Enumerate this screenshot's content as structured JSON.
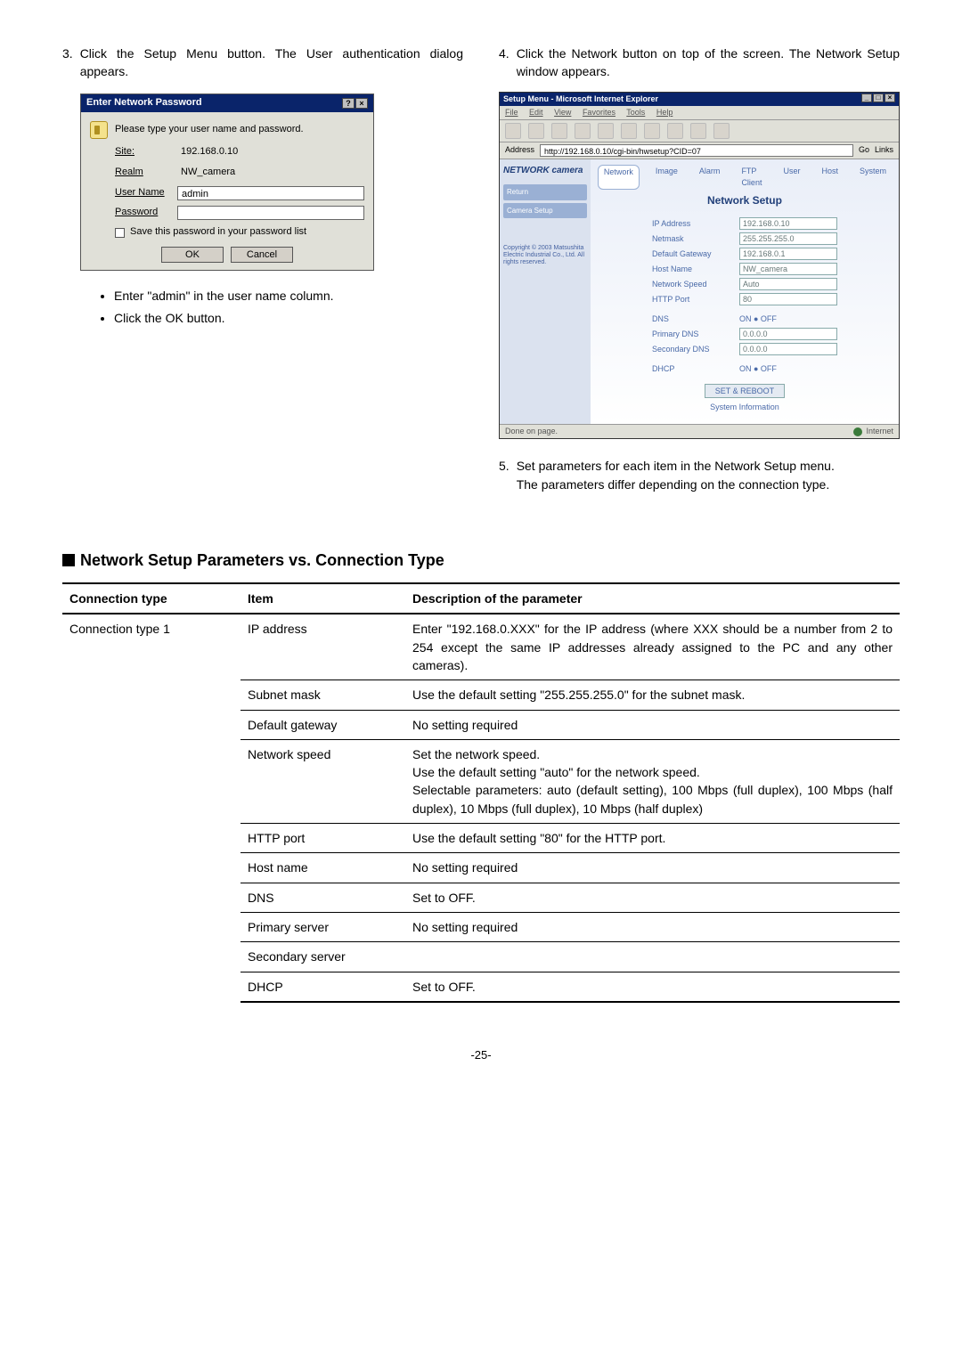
{
  "steps": {
    "s3": {
      "num": "3.",
      "text": "Click the Setup Menu button. The User authentication dialog appears."
    },
    "s4": {
      "num": "4.",
      "text": "Click the Network button on top of the screen. The Network Setup window appears."
    },
    "s5": {
      "num": "5.",
      "text": "Set parameters for each item in the Network Setup menu.",
      "note": "The parameters differ depending on the connection type."
    }
  },
  "bullets": {
    "b1": "Enter \"admin\" in the user name column.",
    "b2": "Click the OK button."
  },
  "dialog": {
    "title": "Enter Network Password",
    "prompt": "Please type your user name and password.",
    "site_label": "Site:",
    "site_value": "192.168.0.10",
    "realm_label": "Realm",
    "realm_value": "NW_camera",
    "user_label": "User Name",
    "user_value": "admin",
    "pass_label": "Password",
    "save_label": "Save this password in your password list",
    "ok": "OK",
    "cancel": "Cancel",
    "help_btn": "?",
    "close_btn": "×"
  },
  "browser": {
    "title": "Setup Menu - Microsoft Internet Explorer",
    "min": "_",
    "max": "□",
    "close": "×",
    "menu": {
      "file": "File",
      "edit": "Edit",
      "view": "View",
      "fav": "Favorites",
      "tools": "Tools",
      "help": "Help"
    },
    "addr_label": "Address",
    "addr_value": "http://192.168.0.10/cgi-bin/hwsetup?CID=07",
    "go": "Go",
    "links": "Links",
    "logo": "NETWORK camera",
    "side_return": "Return",
    "side_camera": "Camera Setup",
    "copyright": "Copyright © 2003 Matsushita Electric Industrial Co., Ltd. All rights reserved.",
    "tabs": {
      "network": "Network",
      "image": "Image",
      "alarm": "Alarm",
      "ftp": "FTP Client",
      "user": "User",
      "host": "Host",
      "system": "System"
    },
    "panel_title": "Network Setup",
    "rows": {
      "ip_l": "IP Address",
      "ip_v": "192.168.0.10",
      "nm_l": "Netmask",
      "nm_v": "255.255.255.0",
      "gw_l": "Default Gateway",
      "gw_v": "192.168.0.1",
      "hn_l": "Host Name",
      "hn_v": "NW_camera",
      "ns_l": "Network Speed",
      "ns_v": "Auto",
      "hp_l": "HTTP Port",
      "hp_v": "80",
      "dns_l": "DNS",
      "dns_v": "ON  ● OFF",
      "pd_l": "Primary DNS",
      "pd_v": "0.0.0.0",
      "sd_l": "Secondary DNS",
      "sd_v": "0.0.0.0",
      "dh_l": "DHCP",
      "dh_v": "ON  ● OFF"
    },
    "set_btn": "SET & REBOOT",
    "sysinfo": "System Information",
    "status_done": "Done on page.",
    "status_zone": "Internet"
  },
  "section_title": "Network Setup Parameters vs. Connection Type",
  "table": {
    "h1": "Connection type",
    "h2": "Item",
    "h3": "Description of the parameter",
    "ct1": "Connection type 1",
    "r1_item": "IP address",
    "r1_desc": "Enter \"192.168.0.XXX\" for the IP address (where XXX should be a number from 2 to 254 except the same IP addresses already assigned to the PC and any other cameras).",
    "r2_item": "Subnet mask",
    "r2_desc": "Use the default setting \"255.255.255.0\" for the subnet mask.",
    "r3_item": "Default gateway",
    "r3_desc": "No setting required",
    "r4_item": "Network speed",
    "r4_desc": "Set the network speed.\nUse the default setting \"auto\" for the network speed.\nSelectable parameters: auto (default setting), 100 Mbps (full duplex), 100 Mbps (half duplex), 10 Mbps (full duplex), 10 Mbps (half duplex)",
    "r5_item": "HTTP port",
    "r5_desc": "Use the default setting \"80\" for the HTTP port.",
    "r6_item": "Host name",
    "r6_desc": "No setting required",
    "r7_item": "DNS",
    "r7_desc": "Set to OFF.",
    "r8_item": "Primary server",
    "r8_desc": "No setting required",
    "r9_item": "Secondary server",
    "r9_desc": "",
    "r10_item": "DHCP",
    "r10_desc": "Set to OFF."
  },
  "page_number": "-25-"
}
